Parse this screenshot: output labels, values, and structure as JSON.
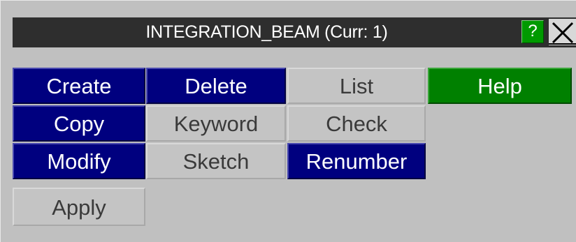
{
  "title": "INTEGRATION_BEAM (Curr: 1)",
  "title_help": "?",
  "buttons": {
    "create": "Create",
    "delete": "Delete",
    "list": "List",
    "help": "Help",
    "copy": "Copy",
    "keyword": "Keyword",
    "check": "Check",
    "modify": "Modify",
    "sketch": "Sketch",
    "renumber": "Renumber",
    "apply": "Apply"
  },
  "colors": {
    "active": "#00007f",
    "inactive": "#c4c4c4",
    "help": "#008000",
    "titlebar": "#2e2e2e",
    "panel": "#c0c0c0"
  },
  "icons": {
    "help": "question-mark-icon",
    "close": "close-icon"
  }
}
